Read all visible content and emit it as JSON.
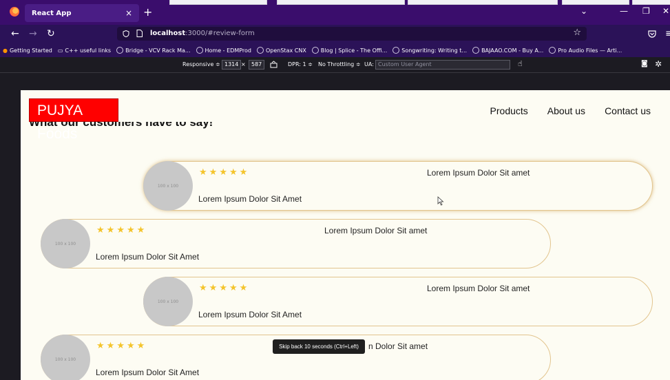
{
  "browser": {
    "tab_title": "React App",
    "tab_close": "×",
    "new_tab": "+",
    "url_host": "localhost",
    "url_rest": ":3000/#review-form",
    "bookmarks": [
      {
        "label": "Getting Started"
      },
      {
        "label": "C++ useful links"
      },
      {
        "label": "Bridge - VCV Rack Ma..."
      },
      {
        "label": "Home - EDMProd"
      },
      {
        "label": "OpenStax CNX"
      },
      {
        "label": "Blog | Splice - The Offi..."
      },
      {
        "label": "Songwriting: Writing t..."
      },
      {
        "label": "BAJAAO.COM - Buy A..."
      },
      {
        "label": "Pro Audio Files — Arti..."
      }
    ]
  },
  "devtools": {
    "device": "Responsive ≑",
    "width": "1314",
    "times": "×",
    "height": "587",
    "dpr": "DPR: 1 ≑",
    "throttling": "No Throttling ≑",
    "ua_label": "UA:",
    "ua_placeholder": "Custom User Agent"
  },
  "site": {
    "logo": "PUJYA Foods",
    "nav": [
      "Products",
      "About us",
      "Contact us"
    ],
    "section_title": "What our customers have to say!"
  },
  "reviews": [
    {
      "avatar": "100 x 100",
      "heading": "Lorem Ipsum Dolor Sit amet",
      "text": "Lorem Ipsum Dolor Sit Amet",
      "stars": 5
    },
    {
      "avatar": "100 x 100",
      "heading": "Lorem Ipsum Dolor Sit amet",
      "text": "Lorem Ipsum Dolor Sit Amet",
      "stars": 5
    },
    {
      "avatar": "100 x 100",
      "heading": "Lorem Ipsum Dolor Sit amet",
      "text": "Lorem Ipsum Dolor Sit Amet",
      "stars": 5
    },
    {
      "avatar": "100 x 100",
      "heading": "n Dolor Sit amet",
      "text": "Lorem Ipsum Dolor Sit Amet",
      "stars": 5
    }
  ],
  "tooltip": "Skip back 10 seconds (Ctrl+Left)",
  "colors": {
    "accent": "#ff0000",
    "star": "#f4c42b",
    "tabbar": "#3a0d6c"
  }
}
